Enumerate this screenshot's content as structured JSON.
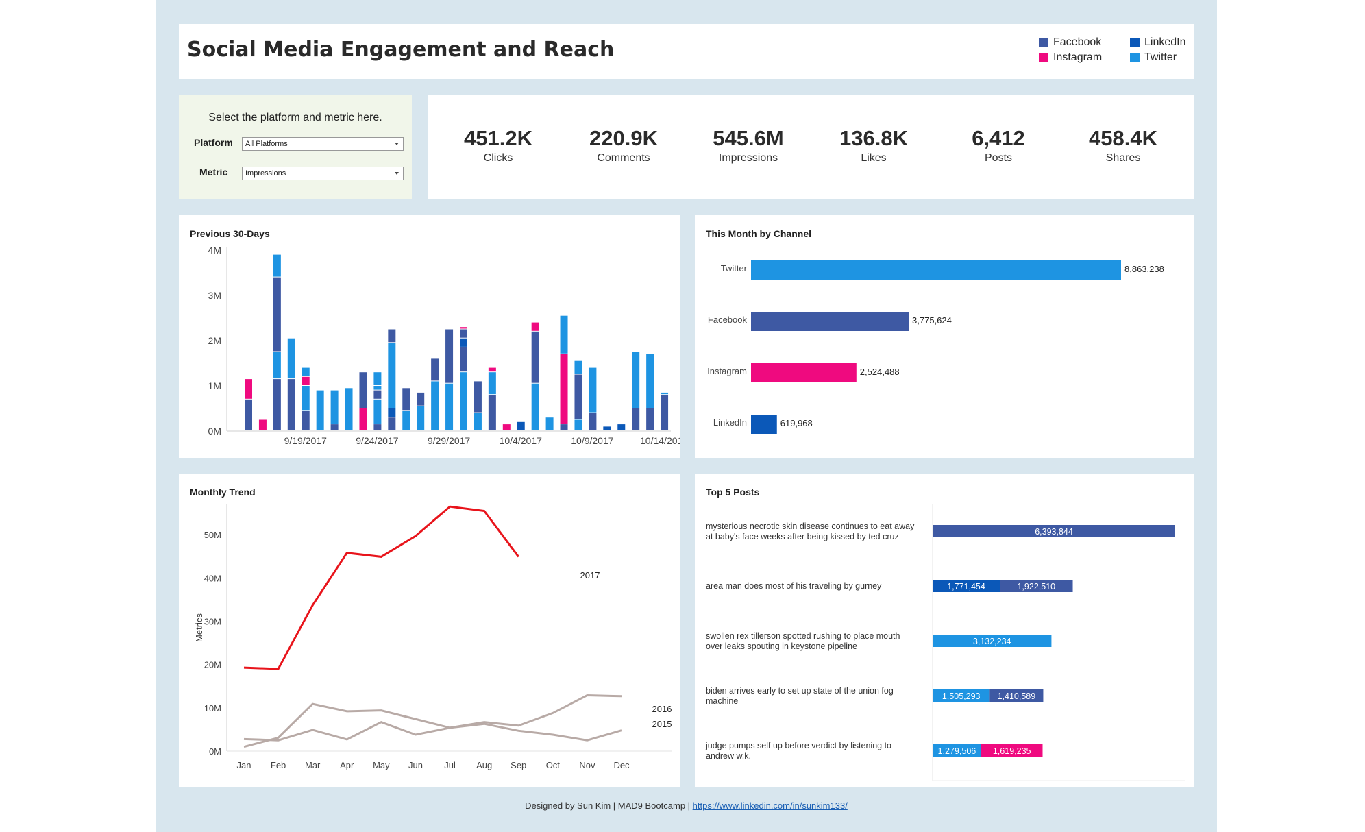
{
  "header": {
    "title": "Social Media Engagement and Reach",
    "legend": [
      {
        "name": "Facebook",
        "color": "#3e59a3"
      },
      {
        "name": "LinkedIn",
        "color": "#0b58b8"
      },
      {
        "name": "Instagram",
        "color": "#ef0a7f"
      },
      {
        "name": "Twitter",
        "color": "#1e94e2"
      }
    ]
  },
  "controls": {
    "prompt": "Select the platform and metric here.",
    "platform_label": "Platform",
    "platform_value": "All Platforms",
    "metric_label": "Metric",
    "metric_value": "Impressions"
  },
  "kpis": [
    {
      "value": "451.2K",
      "label": "Clicks"
    },
    {
      "value": "220.9K",
      "label": "Comments"
    },
    {
      "value": "545.6M",
      "label": "Impressions"
    },
    {
      "value": "136.8K",
      "label": "Likes"
    },
    {
      "value": "6,412",
      "label": "Posts"
    },
    {
      "value": "458.4K",
      "label": "Shares"
    }
  ],
  "colors": {
    "Facebook": "#3e59a3",
    "LinkedIn": "#0b58b8",
    "Instagram": "#ef0a7f",
    "Twitter": "#1e94e2",
    "trend_2017": "#e8141b",
    "trend_other": "#b8aaa6"
  },
  "panels": {
    "daily_title": "Previous 30-Days",
    "channel_title": "This Month by Channel",
    "trend_title": "Monthly Trend",
    "posts_title": "Top 5 Posts"
  },
  "chart_data": [
    {
      "type": "bar",
      "stacked": true,
      "title": "Previous 30-Days",
      "ylim": [
        0,
        4000000
      ],
      "y_ticks": [
        "0M",
        "1M",
        "2M",
        "3M",
        "4M"
      ],
      "x_tick_labels": [
        "9/19/2017",
        "9/24/2017",
        "9/29/2017",
        "10/4/2017",
        "10/9/2017",
        "10/14/2017"
      ],
      "days": [
        [
          [
            "Facebook",
            0.7
          ],
          [
            "Instagram",
            0.45
          ]
        ],
        [
          [
            "Instagram",
            0.25
          ]
        ],
        [
          [
            "Facebook",
            1.15
          ],
          [
            "Twitter",
            0.6
          ],
          [
            "Facebook",
            1.65
          ],
          [
            "Twitter",
            0.5
          ]
        ],
        [
          [
            "Facebook",
            1.15
          ],
          [
            "Twitter",
            0.9
          ]
        ],
        [
          [
            "Facebook",
            0.45
          ],
          [
            "Twitter",
            0.55
          ],
          [
            "Instagram",
            0.2
          ],
          [
            "Twitter",
            0.2
          ]
        ],
        [
          [
            "Twitter",
            0.9
          ]
        ],
        [
          [
            "Facebook",
            0.15
          ],
          [
            "Twitter",
            0.75
          ]
        ],
        [
          [
            "Twitter",
            0.95
          ]
        ],
        [
          [
            "Instagram",
            0.5
          ],
          [
            "Facebook",
            0.8
          ]
        ],
        [
          [
            "Facebook",
            0.15
          ],
          [
            "Twitter",
            0.55
          ],
          [
            "Facebook",
            0.2
          ],
          [
            "Twitter",
            0.1
          ],
          [
            "Twitter",
            0.3
          ]
        ],
        [
          [
            "Facebook",
            0.3
          ],
          [
            "LinkedIn",
            0.2
          ],
          [
            "Twitter",
            1.45
          ],
          [
            "Facebook",
            0.3
          ]
        ],
        [
          [
            "Twitter",
            0.45
          ],
          [
            "Facebook",
            0.5
          ]
        ],
        [
          [
            "Twitter",
            0.55
          ],
          [
            "Facebook",
            0.3
          ]
        ],
        [
          [
            "Twitter",
            1.1
          ],
          [
            "Facebook",
            0.5
          ]
        ],
        [
          [
            "Twitter",
            1.05
          ],
          [
            "Facebook",
            1.2
          ]
        ],
        [
          [
            "Twitter",
            1.3
          ],
          [
            "Facebook",
            0.55
          ],
          [
            "LinkedIn",
            0.2
          ],
          [
            "Facebook",
            0.2
          ],
          [
            "Instagram",
            0.05
          ]
        ],
        [
          [
            "Twitter",
            0.4
          ],
          [
            "Facebook",
            0.7
          ]
        ],
        [
          [
            "Facebook",
            0.8
          ],
          [
            "Twitter",
            0.5
          ],
          [
            "Instagram",
            0.1
          ]
        ],
        [
          [
            "Instagram",
            0.15
          ]
        ],
        [
          [
            "LinkedIn",
            0.2
          ]
        ],
        [
          [
            "Twitter",
            1.05
          ],
          [
            "Facebook",
            1.15
          ],
          [
            "Instagram",
            0.2
          ]
        ],
        [
          [
            "Twitter",
            0.3
          ]
        ],
        [
          [
            "Facebook",
            0.15
          ],
          [
            "Instagram",
            1.55
          ],
          [
            "Twitter",
            0.85
          ]
        ],
        [
          [
            "Twitter",
            0.25
          ],
          [
            "Facebook",
            1.0
          ],
          [
            "Twitter",
            0.3
          ]
        ],
        [
          [
            "Facebook",
            0.4
          ],
          [
            "Twitter",
            1.0
          ]
        ],
        [
          [
            "LinkedIn",
            0.1
          ]
        ],
        [
          [
            "LinkedIn",
            0.15
          ]
        ],
        [
          [
            "Facebook",
            0.5
          ],
          [
            "Twitter",
            1.25
          ]
        ],
        [
          [
            "Facebook",
            0.5
          ],
          [
            "Twitter",
            1.2
          ]
        ],
        [
          [
            "Facebook",
            0.8
          ],
          [
            "Twitter",
            0.05
          ]
        ]
      ]
    },
    {
      "type": "bar",
      "orientation": "horizontal",
      "title": "This Month by Channel",
      "categories": [
        "Twitter",
        "Facebook",
        "Instagram",
        "LinkedIn"
      ],
      "values": [
        8863238,
        3775624,
        2524488,
        619968
      ],
      "labels": [
        "8,863,238",
        "3,775,624",
        "2,524,488",
        "619,968"
      ]
    },
    {
      "type": "line",
      "title": "Monthly Trend",
      "ylabel": "Metrics",
      "ylim": [
        0,
        57000000
      ],
      "y_ticks": [
        "0M",
        "10M",
        "20M",
        "30M",
        "40M",
        "50M"
      ],
      "categories": [
        "Jan",
        "Feb",
        "Mar",
        "Apr",
        "May",
        "Jun",
        "Jul",
        "Aug",
        "Sep",
        "Oct",
        "Nov",
        "Dec"
      ],
      "series": [
        {
          "name": "2017",
          "values": [
            19300000,
            19000000,
            33700000,
            45800000,
            44900000,
            49700000,
            56500000,
            55500000,
            44900000,
            null,
            null,
            null
          ]
        },
        {
          "name": "2016",
          "values": [
            1000000,
            3100000,
            10900000,
            9200000,
            9400000,
            7400000,
            5400000,
            6700000,
            5900000,
            8800000,
            12900000,
            12700000
          ]
        },
        {
          "name": "2015",
          "values": [
            2800000,
            2500000,
            4900000,
            2700000,
            6700000,
            3800000,
            5400000,
            6300000,
            4700000,
            3800000,
            2500000,
            4800000
          ]
        }
      ]
    },
    {
      "type": "bar",
      "orientation": "horizontal",
      "stacked": true,
      "title": "Top 5 Posts",
      "posts": [
        {
          "lines": [
            "mysterious necrotic skin disease continues to eat away",
            "at baby's face weeks after being kissed by ted cruz"
          ],
          "segments": [
            {
              "platform": "Facebook",
              "value": 6393844,
              "label": "6,393,844"
            }
          ]
        },
        {
          "lines": [
            "area man does most of his traveling by gurney"
          ],
          "segments": [
            {
              "platform": "LinkedIn",
              "value": 1771454,
              "label": "1,771,454"
            },
            {
              "platform": "Facebook",
              "value": 1922510,
              "label": "1,922,510"
            }
          ]
        },
        {
          "lines": [
            "swollen rex tillerson spotted rushing to place mouth",
            "over leaks spouting in keystone pipeline"
          ],
          "segments": [
            {
              "platform": "Twitter",
              "value": 3132234,
              "label": "3,132,234"
            }
          ]
        },
        {
          "lines": [
            "biden arrives early to set up state of the union fog",
            "machine"
          ],
          "segments": [
            {
              "platform": "Twitter",
              "value": 1505293,
              "label": "1,505,293"
            },
            {
              "platform": "Facebook",
              "value": 1410589,
              "label": "1,410,589"
            }
          ]
        },
        {
          "lines": [
            "judge pumps self up before verdict by listening to",
            "andrew w.k."
          ],
          "segments": [
            {
              "platform": "Twitter",
              "value": 1279506,
              "label": "1,279,506"
            },
            {
              "platform": "Instagram",
              "value": 1619235,
              "label": "1,619,235"
            }
          ]
        }
      ]
    }
  ],
  "footer": {
    "text": "Designed by Sun Kim | MAD9 Bootcamp | ",
    "link": "https://www.linkedin.com/in/sunkim133/"
  }
}
